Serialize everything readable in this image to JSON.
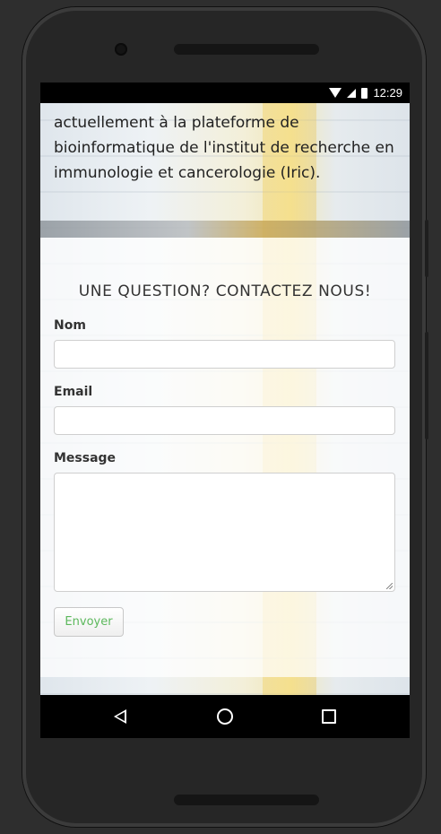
{
  "status_bar": {
    "time": "12:29"
  },
  "bio": {
    "line1": "actuellement à la plateforme de",
    "line2": "bioinformatique de l'institut de recherche en",
    "line3": "immunologie et cancerologie (Iric)."
  },
  "contact_form": {
    "title": "UNE QUESTION? CONTACTEZ NOUS!",
    "name_label": "Nom",
    "name_value": "",
    "email_label": "Email",
    "email_value": "",
    "message_label": "Message",
    "message_value": "",
    "submit_label": "Envoyer"
  },
  "nav": {
    "back_icon": "triangle-back-icon",
    "home_icon": "circle-home-icon",
    "recent_icon": "square-recent-icon"
  },
  "colors": {
    "submit_text": "#5cb85c",
    "statusbar_bg": "#000000",
    "phone_frame": "#262626"
  }
}
